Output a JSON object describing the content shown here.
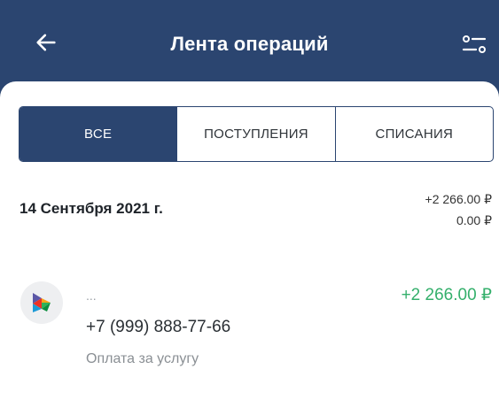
{
  "header": {
    "title": "Лента операций",
    "back_icon": "arrow-left-icon",
    "filter_icon": "sliders-icon",
    "background": "#2b4570"
  },
  "tabs": [
    {
      "label": "ВСЕ",
      "active": true
    },
    {
      "label": "ПОСТУПЛЕНИЯ",
      "active": false
    },
    {
      "label": "СПИСАНИЯ",
      "active": false
    }
  ],
  "day_group": {
    "date": "14 Сентября 2021 г.",
    "income_total": "+2 266.00 ₽",
    "expense_total": "0.00 ₽"
  },
  "operations": [
    {
      "icon": "sbp-logo-icon",
      "name": "...",
      "amount": "+2 266.00 ₽",
      "amount_color": "#35b06c",
      "phone": "+7 (999) 888-77-66",
      "description": "Оплата за услугу"
    }
  ]
}
